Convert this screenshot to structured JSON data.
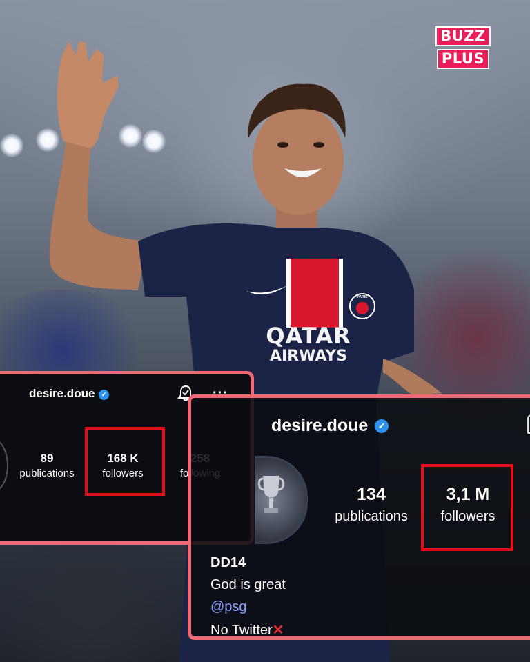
{
  "brand": {
    "line1": "BUZZ",
    "line2": "PLUS"
  },
  "card_old": {
    "username": "desire.doue",
    "stats": [
      {
        "value": "89",
        "label": "publications"
      },
      {
        "value": "168 K",
        "label": "followers"
      },
      {
        "value": "258",
        "label": "following"
      }
    ]
  },
  "card_new": {
    "username": "desire.doue",
    "stats": [
      {
        "value": "134",
        "label": "publications"
      },
      {
        "value": "3,1 M",
        "label": "followers"
      }
    ],
    "bio": {
      "line1": "DD14",
      "line2": "God is great",
      "line3": "@psg",
      "line4": "No Twitter",
      "line4_emoji": "✕"
    }
  },
  "jersey": {
    "sponsor_line1": "QATAR",
    "sponsor_line2": "AIRWAYS",
    "badge": "PARIS"
  },
  "colors": {
    "card_border": "#f06a73",
    "highlight_box": "#e3101a",
    "verified": "#2d93f0",
    "brand": "#e61e5a",
    "jersey": "#1b2447"
  },
  "icons": [
    "verified-badge-icon",
    "bell-icon",
    "more-icon",
    "trophy-icon",
    "cross-mark-icon"
  ]
}
